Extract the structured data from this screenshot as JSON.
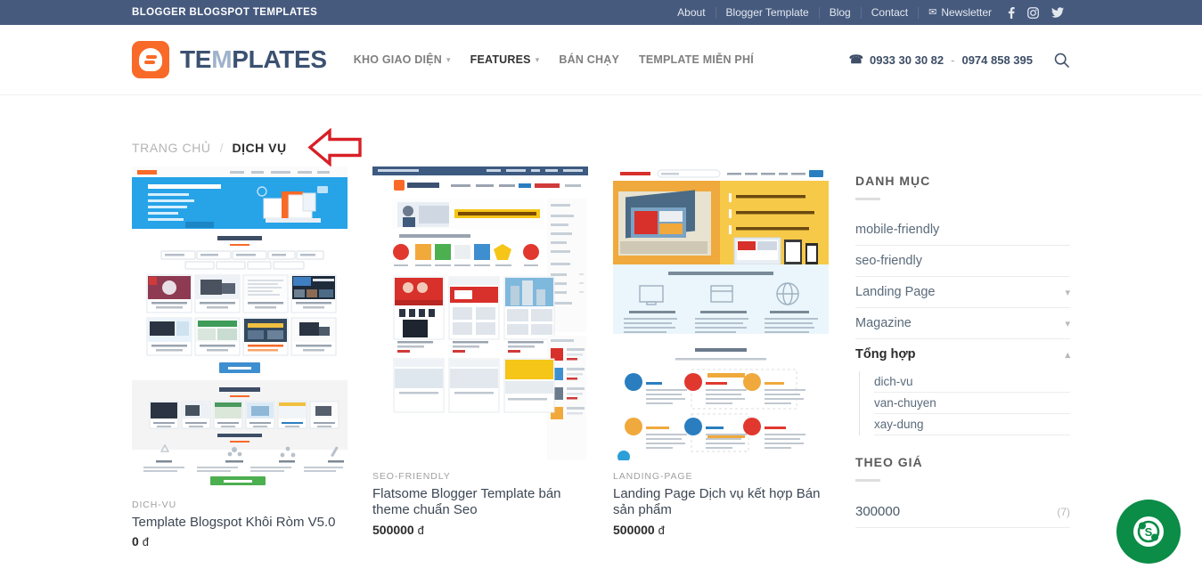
{
  "topbar": {
    "site_title": "BLOGGER BLOGSPOT TEMPLATES",
    "links": [
      {
        "label": "About",
        "name": "topbar-link-about"
      },
      {
        "label": "Blogger Template",
        "name": "topbar-link-blogger-template"
      },
      {
        "label": "Blog",
        "name": "topbar-link-blog"
      },
      {
        "label": "Contact",
        "name": "topbar-link-contact"
      }
    ],
    "newsletter_label": "Newsletter",
    "newsletter_icon": "envelope-icon",
    "social": [
      {
        "icon": "facebook-icon",
        "glyph": "f"
      },
      {
        "icon": "instagram-icon",
        "glyph": "▣"
      },
      {
        "icon": "twitter-icon",
        "glyph": "✉"
      }
    ],
    "background_color": "#465a7e"
  },
  "header": {
    "logo_text_a": "TE",
    "logo_text_m": "M",
    "logo_text_b": "PLATES",
    "logo_icon": "blogger-logo-icon",
    "nav": [
      {
        "label": "KHO GIAO DIỆN",
        "has_caret": true,
        "active": false
      },
      {
        "label": "FEATURES",
        "has_caret": true,
        "active": true
      },
      {
        "label": "BÁN CHẠY",
        "has_caret": false,
        "active": false
      },
      {
        "label": "TEMPLATE MIỄN PHÍ",
        "has_caret": false,
        "active": false
      }
    ],
    "phone_icon": "phone-icon",
    "phone_1": "0933 30 30 82",
    "phone_sep": "-",
    "phone_2": "0974 858 395",
    "search_icon": "search-icon"
  },
  "breadcrumb": {
    "home": "TRANG CHỦ",
    "separator": "/",
    "current": "DỊCH VỤ",
    "annotation_icon": "red-left-arrow-annotation",
    "annotation_color": "#d81f26"
  },
  "products": [
    {
      "category": "DICH-VU",
      "title": "Template Blogspot Khôi Ròm V5.0",
      "price": "0",
      "currency": "đ",
      "thumb": "blogspot-homepage-blue-hero"
    },
    {
      "category": "SEO-FRIENDLY",
      "title": "Flatsome Blogger Template bán theme chuẩn Seo",
      "price": "500000",
      "currency": "đ",
      "thumb": "ecommerce-template-red-grid"
    },
    {
      "category": "LANDING-PAGE",
      "title": "Landing Page Dịch vụ kết hợp Bán sản phẩm",
      "price": "500000",
      "currency": "đ",
      "thumb": "landing-page-yellow-hero"
    }
  ],
  "sidebar": {
    "categories_title": "DANH MỤC",
    "categories": [
      {
        "label": "mobile-friendly",
        "expandable": false,
        "expanded": false,
        "bold": false
      },
      {
        "label": "seo-friendly",
        "expandable": false,
        "expanded": false,
        "bold": false
      },
      {
        "label": "Landing Page",
        "expandable": true,
        "expanded": false,
        "bold": false,
        "chevron": "chevron-down-icon"
      },
      {
        "label": "Magazine",
        "expandable": true,
        "expanded": false,
        "bold": false,
        "chevron": "chevron-down-icon"
      },
      {
        "label": "Tổng hợp",
        "expandable": true,
        "expanded": true,
        "bold": true,
        "chevron": "chevron-up-icon"
      }
    ],
    "subitems": [
      {
        "label": "dich-vu"
      },
      {
        "label": "van-chuyen"
      },
      {
        "label": "xay-dung"
      }
    ],
    "price_title": "THEO GIÁ",
    "prices": [
      {
        "label": "300000",
        "count": "(7)"
      }
    ]
  },
  "floating": {
    "skype_icon": "skype-icon",
    "skype_color": "#0b8c47",
    "skype_glyph": "S"
  }
}
